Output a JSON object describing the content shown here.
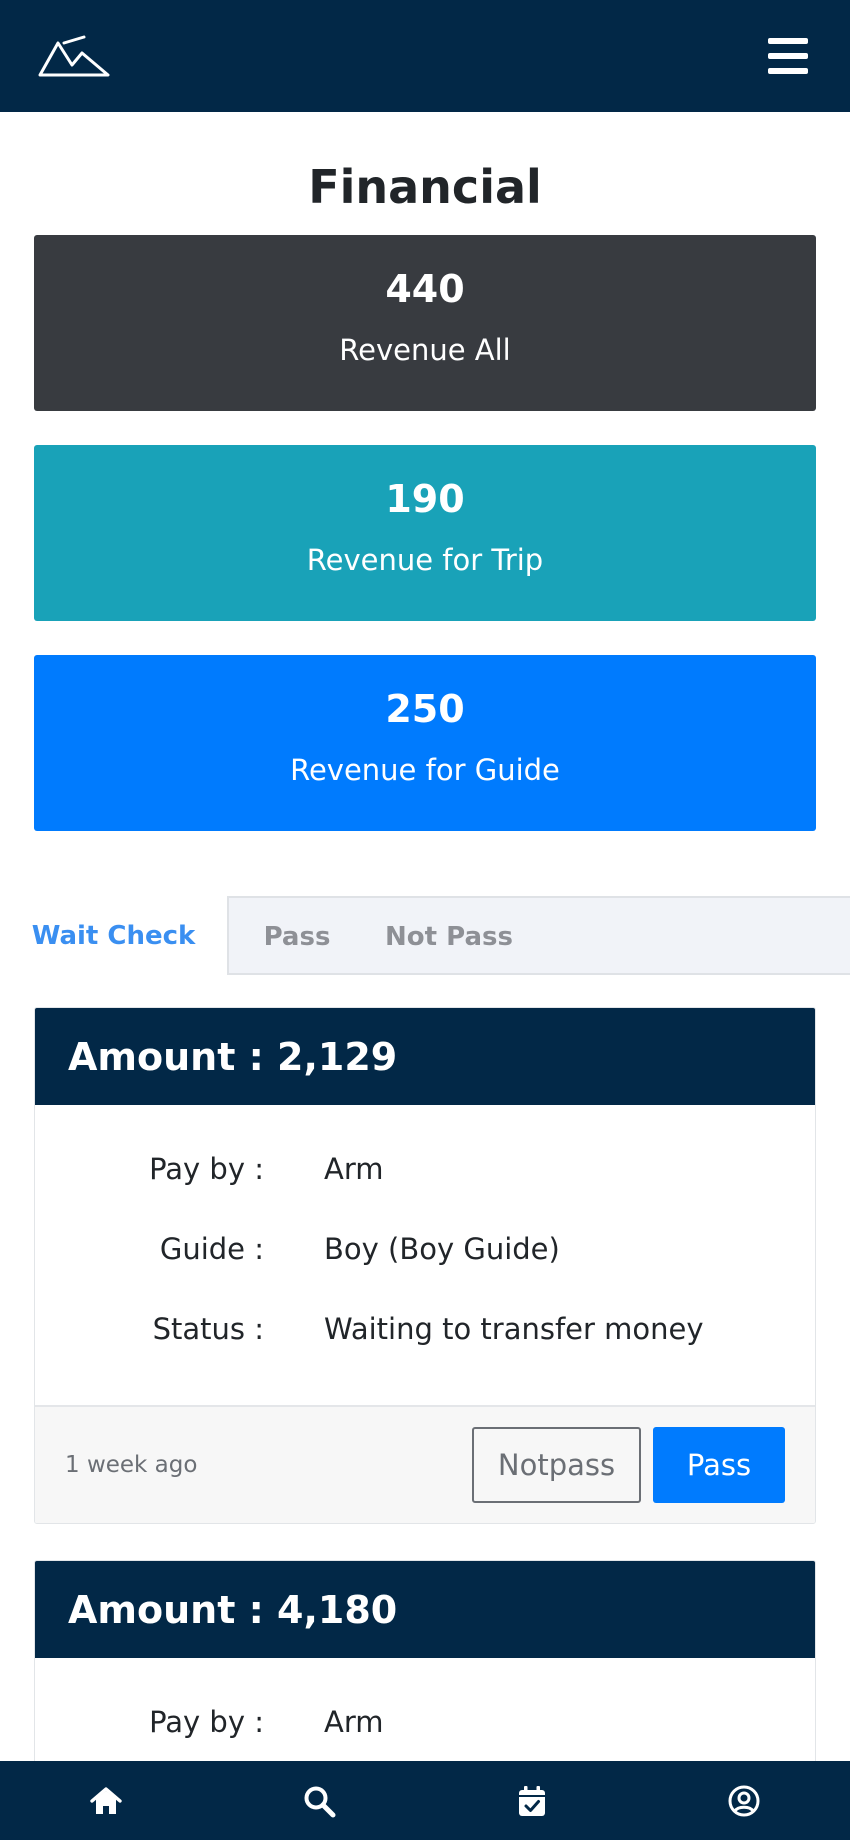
{
  "header": {
    "logo_icon": "mountain-logo-icon",
    "menu_icon": "hamburger-icon"
  },
  "page": {
    "title": "Financial"
  },
  "stats": [
    {
      "value": "440",
      "label": "Revenue All",
      "color": "#383b40"
    },
    {
      "value": "190",
      "label": "Revenue for Trip",
      "color": "#19a2b8"
    },
    {
      "value": "250",
      "label": "Revenue for Guide",
      "color": "#007bfe"
    }
  ],
  "tabs": {
    "wait_check": "Wait Check",
    "pass": "Pass",
    "not_pass": "Not Pass",
    "active": "Wait Check"
  },
  "cards": [
    {
      "amount": "Amount : 2,129",
      "pay_by_label": "Pay by :",
      "pay_by": "Arm",
      "guide_label": "Guide :",
      "guide": "Boy (Boy Guide)",
      "status_label": "Status :",
      "status": "Waiting to transfer money",
      "time_ago": "1 week ago",
      "notpass_label": "Notpass",
      "pass_label": "Pass"
    },
    {
      "amount": "Amount : 4,180",
      "pay_by_label": "Pay by :",
      "pay_by": "Arm"
    }
  ],
  "bottom_nav": [
    "home-icon",
    "search-icon",
    "calendar-check-icon",
    "user-circle-icon"
  ],
  "colors": {
    "navy": "#022847",
    "primary": "#007bfe",
    "info": "#19a2b8",
    "dark": "#383b40",
    "tab_active": "#3a8ff1"
  }
}
